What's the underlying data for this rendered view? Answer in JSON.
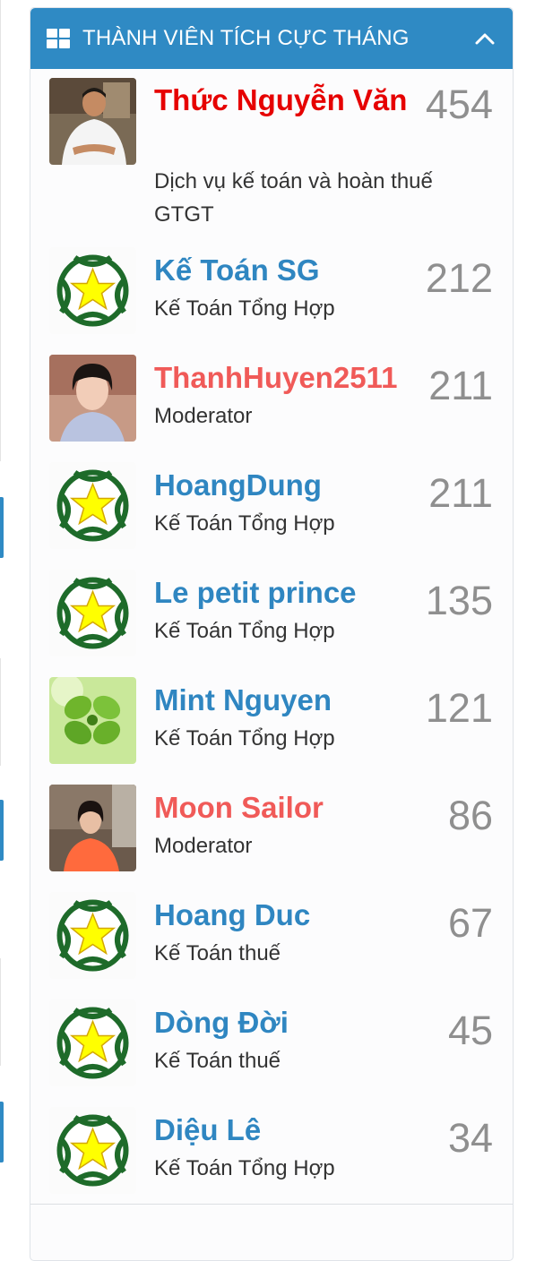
{
  "widget": {
    "title": "THÀNH VIÊN TÍCH CỰC THÁNG",
    "colors": {
      "header": "#2f8ac4",
      "name_default": "#2f86c1",
      "name_admin": "#e60000",
      "name_moderator": "#f05a58",
      "count": "#8f8f8f"
    }
  },
  "members": [
    {
      "name": "Thức Nguyễn Văn",
      "title": "Dịch vụ kế toán và hoàn thuế GTGT",
      "count": "454",
      "avatar": "man-photo",
      "role": "admin"
    },
    {
      "name": "Kế Toán SG",
      "title": "Kế Toán Tổng Hợp",
      "count": "212",
      "avatar": "star-badge",
      "role": "member"
    },
    {
      "name": "ThanhHuyen2511",
      "title": "Moderator",
      "count": "211",
      "avatar": "woman-photo",
      "role": "moderator"
    },
    {
      "name": "HoangDung",
      "title": "Kế Toán Tổng Hợp",
      "count": "211",
      "avatar": "star-badge",
      "role": "member"
    },
    {
      "name": "Le petit prince",
      "title": "Kế Toán Tổng Hợp",
      "count": "135",
      "avatar": "star-badge",
      "role": "member"
    },
    {
      "name": "Mint Nguyen",
      "title": "Kế Toán Tổng Hợp",
      "count": "121",
      "avatar": "mint-leaf-photo",
      "role": "member"
    },
    {
      "name": "Moon Sailor",
      "title": "Moderator",
      "count": "86",
      "avatar": "woman-orange-photo",
      "role": "moderator"
    },
    {
      "name": "Hoang Duc",
      "title": "Kế Toán thuế",
      "count": "67",
      "avatar": "star-badge",
      "role": "member"
    },
    {
      "name": "Dòng Đời",
      "title": "Kế Toán thuế",
      "count": "45",
      "avatar": "star-badge",
      "role": "member"
    },
    {
      "name": "Diệu Lê",
      "title": "Kế Toán Tổng Hợp",
      "count": "34",
      "avatar": "star-badge",
      "role": "member"
    }
  ]
}
